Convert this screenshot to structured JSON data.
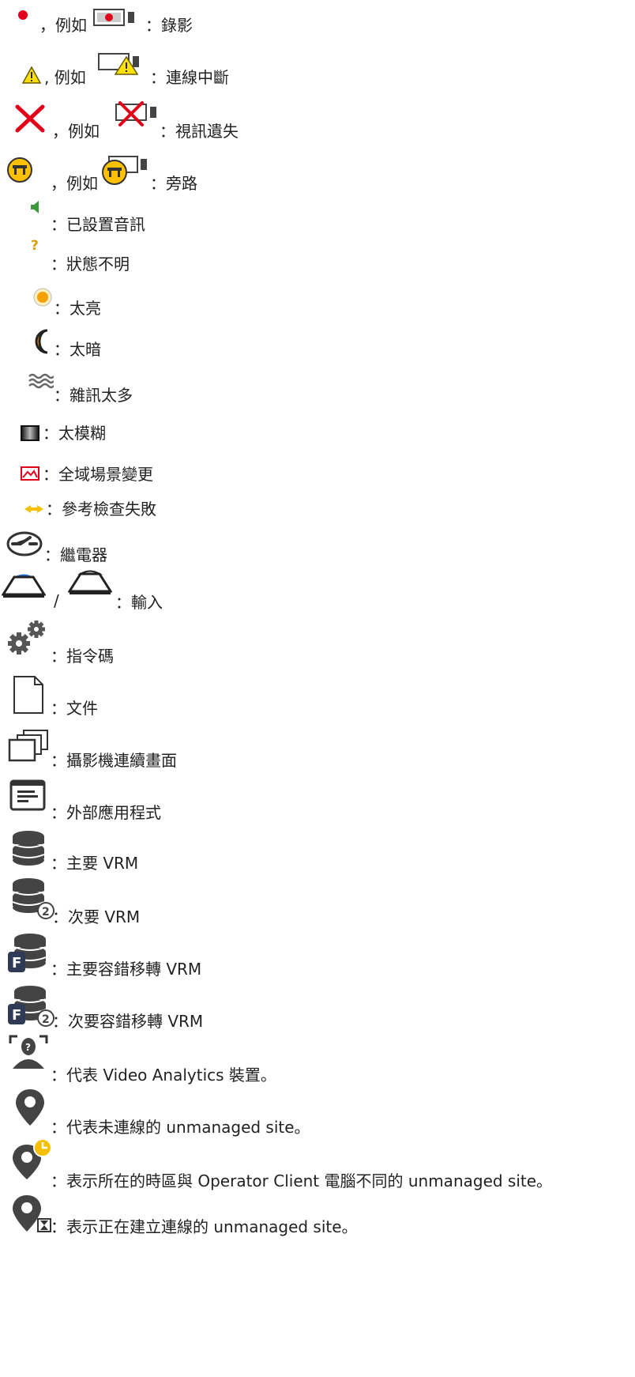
{
  "legend": [
    {
      "icon": "record-dot-icon",
      "prefix": "，例如",
      "text": "：錄影"
    },
    {
      "icon": "warning-triangle-icon",
      "prefix": ", 例如",
      "text": "：連線中斷"
    },
    {
      "icon": "red-x-icon",
      "prefix": "，例如",
      "text": "：視訊遺失"
    },
    {
      "icon": "bypass-icon",
      "prefix": "，例如",
      "text": "：旁路"
    },
    {
      "icon": "speaker-icon",
      "text": "：已設置音訊"
    },
    {
      "icon": "question-mark-icon",
      "text": "：狀態不明"
    },
    {
      "icon": "sun-icon",
      "text": "：太亮"
    },
    {
      "icon": "moon-icon",
      "text": "：太暗"
    },
    {
      "icon": "noise-icon",
      "text": "：雜訊太多"
    },
    {
      "icon": "blur-icon",
      "text": "：太模糊"
    },
    {
      "icon": "scene-change-icon",
      "text": "：全域場景變更"
    },
    {
      "icon": "reference-check-icon",
      "text": "：參考檢查失敗"
    },
    {
      "icon": "relay-icon",
      "text": "：繼電器"
    },
    {
      "icon": "input-icon",
      "text": "：輸入",
      "separator": "/"
    },
    {
      "icon": "gears-icon",
      "text": "：指令碼"
    },
    {
      "icon": "document-icon",
      "text": "：文件"
    },
    {
      "icon": "camera-sequence-icon",
      "text": "：攝影機連續畫面"
    },
    {
      "icon": "external-app-icon",
      "text": "：外部應用程式"
    },
    {
      "icon": "vrm-primary-icon",
      "text": "：主要 VRM"
    },
    {
      "icon": "vrm-secondary-icon",
      "text": "：次要 VRM"
    },
    {
      "icon": "vrm-failover-primary-icon",
      "text": "：主要容錯移轉 VRM"
    },
    {
      "icon": "vrm-failover-secondary-icon",
      "text": "：次要容錯移轉 VRM"
    },
    {
      "icon": "video-analytics-icon",
      "text": "：代表 Video Analytics 裝置。"
    },
    {
      "icon": "site-pin-icon",
      "text": "：代表未連線的 unmanaged site。"
    },
    {
      "icon": "site-timezone-icon",
      "text": "：表示所在的時區與 Operator Client 電腦不同的 unmanaged site。"
    },
    {
      "icon": "site-connecting-icon",
      "text": "：表示正在建立連線的 unmanaged site。"
    }
  ]
}
